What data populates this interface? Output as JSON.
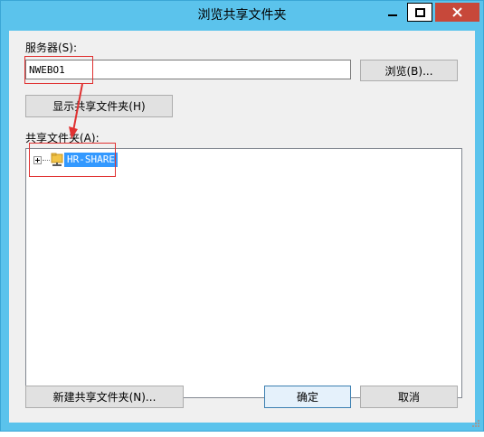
{
  "window": {
    "title": "浏览共享文件夹",
    "accent_color": "#5bc3ec",
    "close_color": "#c7483a"
  },
  "server": {
    "label": "服务器(S):",
    "value": "NWEBO1",
    "browse_button": "浏览(B)..."
  },
  "show_folders_button": "显示共享文件夹(H)",
  "folders": {
    "label": "共享文件夹(A):",
    "tree": [
      {
        "label": "HR-SHARE",
        "icon": "share-folder-icon",
        "expander": "plus",
        "selected": true
      }
    ]
  },
  "footer": {
    "new_folder_button": "新建共享文件夹(N)...",
    "ok_button": "确定",
    "cancel_button": "取消"
  },
  "annotation_color": "#e03131"
}
